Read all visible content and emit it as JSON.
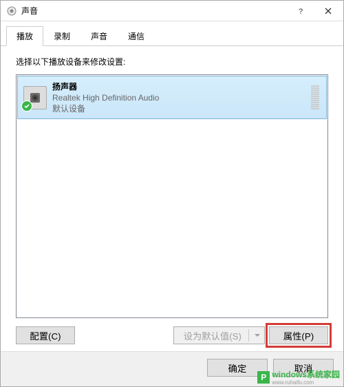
{
  "window": {
    "title": "声音"
  },
  "tabs": [
    {
      "label": "播放",
      "active": true
    },
    {
      "label": "录制",
      "active": false
    },
    {
      "label": "声音",
      "active": false
    },
    {
      "label": "通信",
      "active": false
    }
  ],
  "instruction": "选择以下播放设备来修改设置:",
  "devices": [
    {
      "name": "扬声器",
      "description": "Realtek High Definition Audio",
      "status": "默认设备",
      "is_default": true,
      "selected": true
    }
  ],
  "buttons": {
    "configure": "配置(C)",
    "set_default": "设为默认值(S)",
    "set_default_enabled": false,
    "properties": "属性(P)"
  },
  "footer": {
    "ok": "确定",
    "cancel": "取消"
  },
  "watermark": {
    "brand": "windows",
    "brand_suffix": "系统家园",
    "sub": "www.ruhaifu.com"
  }
}
